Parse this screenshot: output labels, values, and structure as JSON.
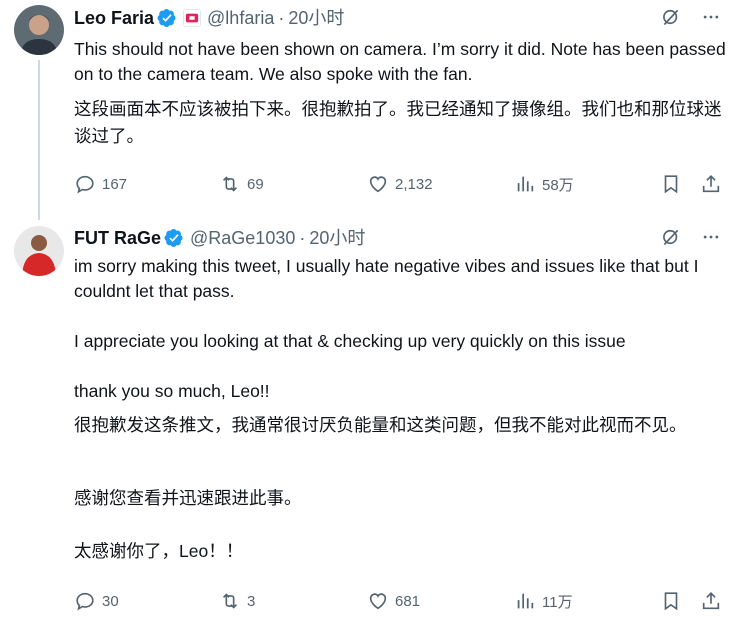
{
  "tweets": [
    {
      "name": "Leo Faria",
      "handle": "@lhfaria",
      "time": "20小时",
      "text_en": "This should not have been shown on camera. I’m sorry it did. Note has been passed on to the camera team. We also spoke with the fan.",
      "text_zh": "这段画面本不应该被拍下来。很抱歉拍了。我已经通知了摄像组。我们也和那位球迷谈过了。",
      "replies": "167",
      "retweets": "69",
      "likes": "2,132",
      "views": "58万"
    },
    {
      "name": "FUT RaGe",
      "handle": "@RaGe1030",
      "time": "20小时",
      "text_en_1": "im sorry making this tweet, I usually hate negative vibes and issues like that but I couldnt let that pass.",
      "text_en_2": "I appreciate you looking at that & checking up very quickly on this issue",
      "text_en_3": "thank you so much, Leo!!",
      "text_zh_1": "很抱歉发这条推文，我通常很讨厌负能量和这类问题，但我不能对此视而不见。",
      "text_zh_2": "感谢您查看并迅速跟进此事。",
      "text_zh_3": "太感谢你了，Leo！！",
      "replies": "30",
      "retweets": "3",
      "likes": "681",
      "views": "11万"
    }
  ],
  "separator": "·",
  "icons": {
    "verified": "verified-badge-icon",
    "affiliation": "affiliation-badge-icon",
    "grok": "grok-icon",
    "more": "more-icon",
    "reply": "reply-icon",
    "retweet": "retweet-icon",
    "like": "like-icon",
    "views": "views-icon",
    "bookmark": "bookmark-icon",
    "share": "share-icon"
  },
  "colors": {
    "text": "#0f1419",
    "secondary": "#536471",
    "verified": "#1d9bf0",
    "affiliation": "#e0245e"
  }
}
